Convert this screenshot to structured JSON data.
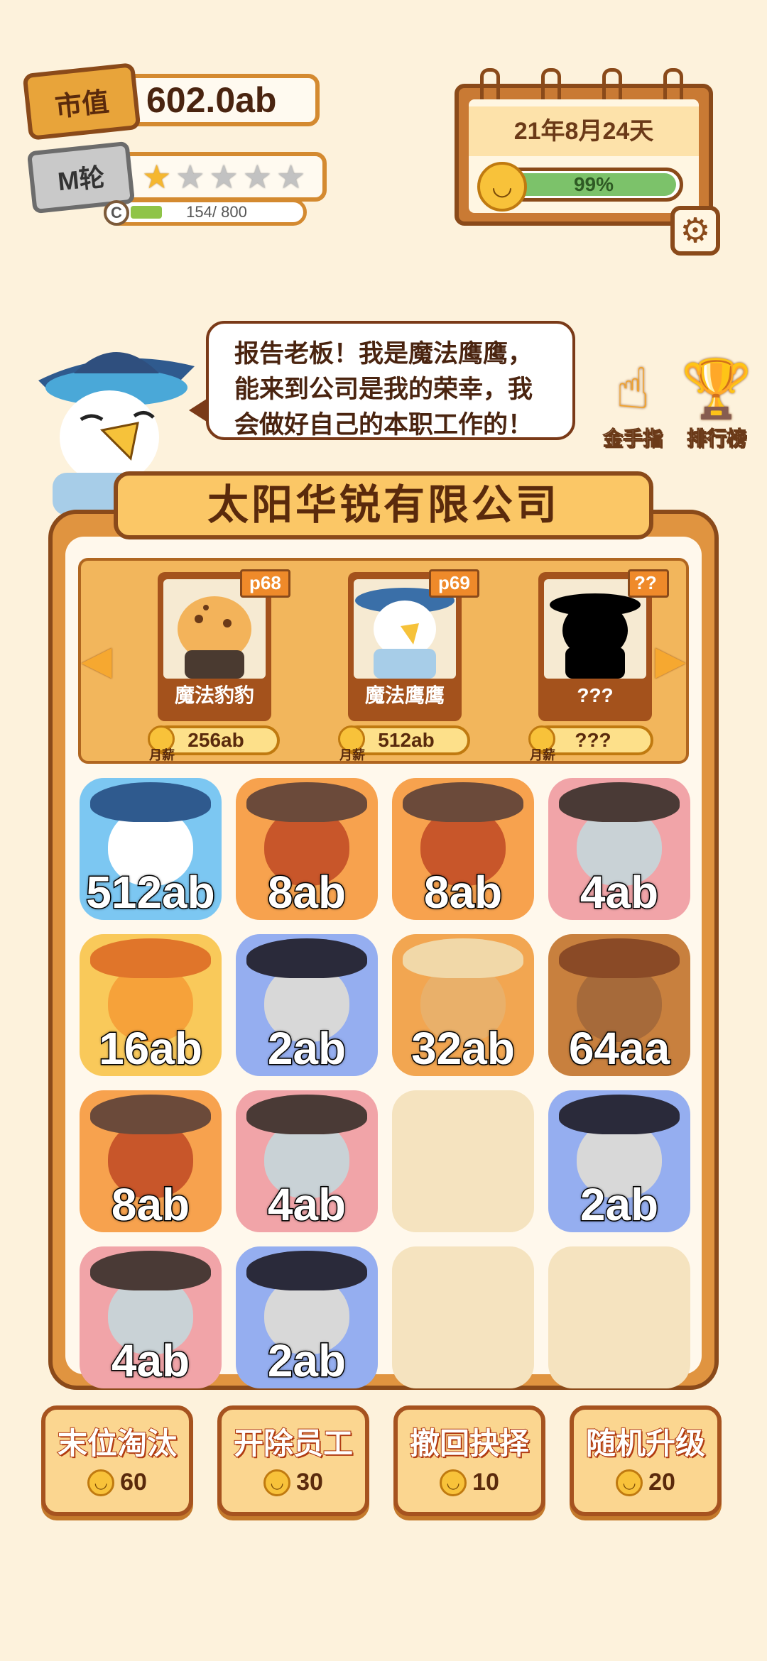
{
  "hud": {
    "market_label": "市值",
    "market_value": "602.0ab",
    "rank_label": "M轮",
    "stars_total": 5,
    "stars_filled": 1,
    "exp_letter": "C",
    "exp_text": "154/ 800",
    "exp_fraction": 0.1925
  },
  "calendar": {
    "date": "21年8月24天",
    "mood": "99%",
    "mood_fraction": 0.99
  },
  "speech": {
    "line1": "报告老板！我是魔法鹰鹰，",
    "line2": "能来到公司是我的荣幸，我",
    "line3": "会做好自己的本职工作的！"
  },
  "side_buttons": {
    "golden_finger": "金手指",
    "leaderboard": "排行榜"
  },
  "company": {
    "name": "太阳华锐有限公司"
  },
  "employees": [
    {
      "name": "魔法豹豹",
      "tag": "p68",
      "salary_label": "月薪",
      "salary": "256ab"
    },
    {
      "name": "魔法鹰鹰",
      "tag": "p69",
      "salary_label": "月薪",
      "salary": "512ab"
    },
    {
      "name": "???",
      "tag": "??",
      "salary_label": "月薪",
      "salary": "???"
    }
  ],
  "grid": [
    {
      "label": "512ab",
      "animal": "eagle",
      "bg": "#7cc7f2"
    },
    {
      "label": "8ab",
      "animal": "red-panda",
      "bg": "#f7a24e"
    },
    {
      "label": "8ab",
      "animal": "red-panda",
      "bg": "#f7a24e"
    },
    {
      "label": "4ab",
      "animal": "mouse",
      "bg": "#f1a4a8"
    },
    {
      "label": "16ab",
      "animal": "cat",
      "bg": "#f9c95a"
    },
    {
      "label": "2ab",
      "animal": "hamster",
      "bg": "#95aef0"
    },
    {
      "label": "32ab",
      "animal": "shiba",
      "bg": "#f2a651"
    },
    {
      "label": "64aa",
      "animal": "bear",
      "bg": "#c8803e"
    },
    {
      "label": "8ab",
      "animal": "red-panda",
      "bg": "#f7a24e"
    },
    {
      "label": "4ab",
      "animal": "mouse",
      "bg": "#f1a4a8"
    },
    {
      "label": "",
      "animal": "empty",
      "bg": ""
    },
    {
      "label": "2ab",
      "animal": "hamster",
      "bg": "#95aef0"
    },
    {
      "label": "4ab",
      "animal": "mouse",
      "bg": "#f1a4a8"
    },
    {
      "label": "2ab",
      "animal": "hamster",
      "bg": "#95aef0"
    },
    {
      "label": "",
      "animal": "empty",
      "bg": ""
    },
    {
      "label": "",
      "animal": "empty",
      "bg": ""
    }
  ],
  "actions": [
    {
      "title": "末位淘汰",
      "cost": "60"
    },
    {
      "title": "开除员工",
      "cost": "30"
    },
    {
      "title": "撤回抉择",
      "cost": "10"
    },
    {
      "title": "随机升级",
      "cost": "20"
    }
  ],
  "icons": {
    "gear": "gear-icon",
    "mood": "smile-icon",
    "golden_finger": "pointing-hand-icon",
    "leaderboard": "trophy-icon"
  },
  "colors": {
    "background": "#fdf2dc",
    "frame_brown": "#8a4a1a",
    "mood_green": "#7cc26a",
    "exp_green": "#8fc448"
  }
}
